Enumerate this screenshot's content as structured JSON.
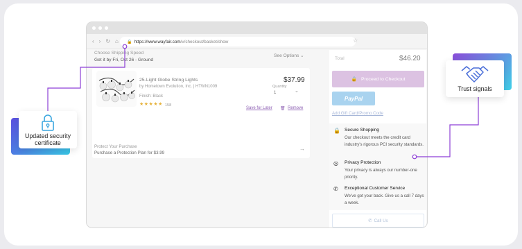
{
  "browser": {
    "url_host": "https://www.wayfair.com",
    "url_path": "/v/checkout/basket/show"
  },
  "cart": {
    "shipping_speed_label": "Choose Shipping Speed",
    "shipping_eta": "Get it by Fri, Oct 26 - Ground",
    "see_options": "See Options",
    "product": {
      "title": "25-Light Globe String Lights",
      "brand": "by Hometown Evolution, Inc. | HTWN1009",
      "finish": "Finish: Black",
      "rating_stars": "★★★★★",
      "rating_count": "158",
      "price": "$37.99",
      "quantity_label": "Quantity",
      "quantity_value": "1",
      "save_later": "Save for Later",
      "remove": "Remove"
    },
    "protect_line1": "Protect Your Purchase",
    "protect_line2": "Purchase a Protection Plan for $3.99"
  },
  "summary": {
    "total_label": "Total",
    "total_value": "$46.20",
    "checkout_button": "Proceed to Checkout",
    "paypal_button": "PayPal",
    "gift_card_link": "Add Gift Card/Promo Code",
    "call_button": "Call Us"
  },
  "trust": [
    {
      "icon": "lock-icon",
      "heading": "Secure Shopping",
      "description": "Our checkout meets the credit card industry's rigorous PCI security standards."
    },
    {
      "icon": "eye-slash-icon",
      "heading": "Privacy Protection",
      "description": "Your privacy is always our number-one priority."
    },
    {
      "icon": "phone-icon",
      "heading": "Exceptional Customer Service",
      "description": "We've got your back. Give us a call 7 days a week."
    }
  ],
  "annotations": {
    "left_label": "Updated security certificate",
    "right_label": "Trust signals"
  },
  "colors": {
    "accent_purple": "#8d3fd6",
    "checkout_button": "#dcc2e2",
    "paypal_button": "#a9d3ef",
    "badge_gradient_start": "#6a5be8",
    "badge_gradient_end": "#3fd0e8"
  }
}
